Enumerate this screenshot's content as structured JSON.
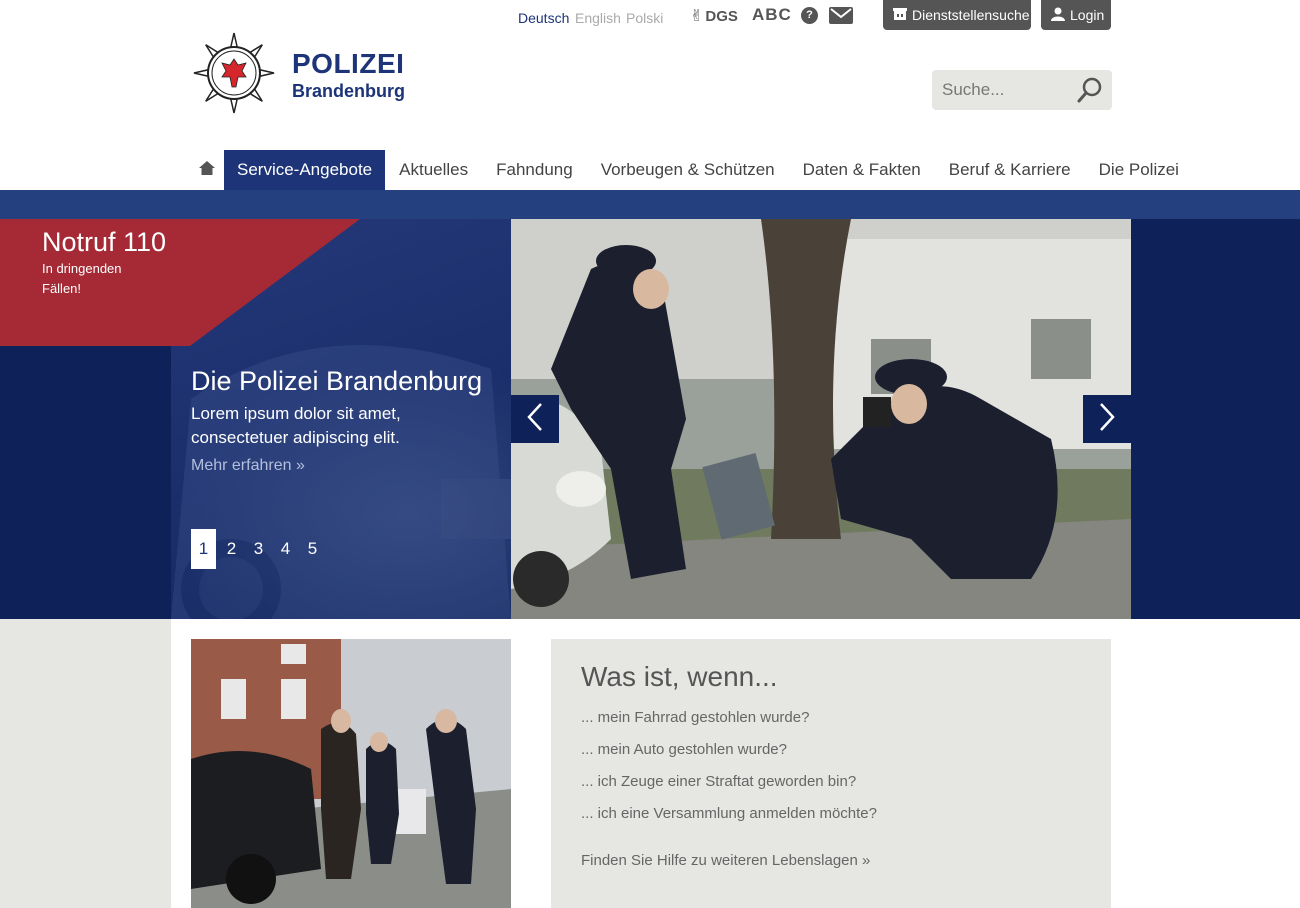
{
  "languages": [
    {
      "label": "Deutsch",
      "active": true
    },
    {
      "label": "English",
      "active": false
    },
    {
      "label": "Polski",
      "active": false
    }
  ],
  "utility": {
    "dgs_label": "DGS",
    "abc_label": "ABC",
    "help_label": "?",
    "station_search_label": "Dienststellensuche",
    "login_label": "Login"
  },
  "logo": {
    "title": "POLIZEI",
    "subtitle": "Brandenburg"
  },
  "search": {
    "placeholder": "Suche..."
  },
  "nav": {
    "items": [
      {
        "label": "Service-Angebote",
        "active": true
      },
      {
        "label": "Aktuelles",
        "active": false
      },
      {
        "label": "Fahndung",
        "active": false
      },
      {
        "label": "Vorbeugen & Schützen",
        "active": false
      },
      {
        "label": "Daten & Fakten",
        "active": false
      },
      {
        "label": "Beruf & Karriere",
        "active": false
      },
      {
        "label": "Die Polizei",
        "active": false
      }
    ]
  },
  "emergency": {
    "title": "Notruf 110",
    "subtitle": "In dringenden Fällen!"
  },
  "hero": {
    "heading": "Die Polizei Brandenburg",
    "text": "Lorem ipsum dolor sit amet, consectetuer adipiscing elit.",
    "more_link": "Mehr erfahren »",
    "pages": [
      "1",
      "2",
      "3",
      "4",
      "5"
    ],
    "active_page": 1
  },
  "faq": {
    "title": "Was ist, wenn...",
    "items": [
      "... mein Fahrrad gestohlen wurde?",
      "... mein Auto gestohlen wurde?",
      "... ich Zeuge einer Straftat geworden bin?",
      "... ich eine Versammlung anmelden möchte?"
    ],
    "more_link": "Finden Sie Hilfe zu weiteren Lebenslagen »"
  },
  "colors": {
    "brand_blue": "#1d3478",
    "hero_navy": "#0e2159",
    "emergency_red": "#a52a35",
    "panel_gray": "#e6e6e3"
  }
}
